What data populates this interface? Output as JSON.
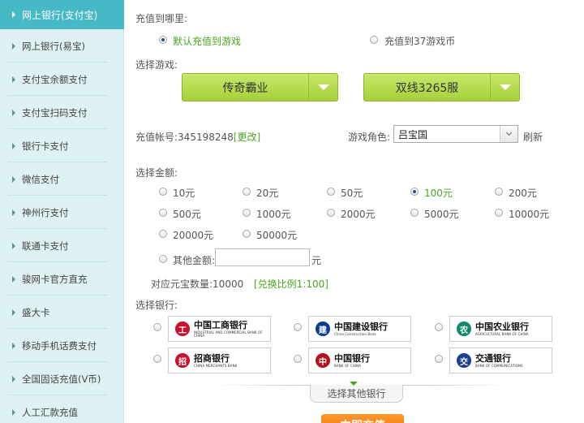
{
  "sidebar": {
    "items": [
      {
        "label": "网上银行(支付宝)",
        "active": true
      },
      {
        "label": "网上银行(易宝)"
      },
      {
        "label": "支付宝余额支付"
      },
      {
        "label": "支付宝扫码支付"
      },
      {
        "label": "银行卡支付"
      },
      {
        "label": "微信支付"
      },
      {
        "label": "神州行支付"
      },
      {
        "label": "联通卡支付"
      },
      {
        "label": "骏网卡官方直充"
      },
      {
        "label": "盛大卡"
      },
      {
        "label": "移动手机话费支付"
      },
      {
        "label": "全国固话充值(V币)"
      },
      {
        "label": "人工汇款充值"
      }
    ]
  },
  "recharge_target": {
    "label": "充值到哪里:",
    "options": [
      "默认充值到游戏",
      "充值到37游戏币"
    ],
    "selected": 0
  },
  "game_select": {
    "label": "选择游戏:",
    "game": "传奇霸业",
    "server": "双线3265服"
  },
  "account": {
    "label": "充值帐号:",
    "value": "345198248",
    "change_link": "[更改]",
    "role_label": "游戏角色:",
    "role_value": "吕宝国",
    "refresh": "刷新"
  },
  "amount": {
    "label": "选择金额:",
    "options": [
      "10元",
      "20元",
      "50元",
      "100元",
      "200元",
      "500元",
      "1000元",
      "2000元",
      "5000元",
      "10000元",
      "20000元",
      "50000元"
    ],
    "selected": 3,
    "other_label": "其他金额:",
    "other_value": "",
    "other_unit": "元",
    "yuanbao_label": "对应元宝数量:10000",
    "ratio_text": "[兑换比例1:100]"
  },
  "bank": {
    "label": "选择银行:",
    "banks": [
      {
        "cn": "中国工商银行",
        "en": "INDUSTRIAL AND COMMERCIAL BANK OF CHINA",
        "logo": "工",
        "color": "#c8102e"
      },
      {
        "cn": "中国建设银行",
        "en": "China Construction Bank",
        "logo": "建",
        "color": "#0a3d8f"
      },
      {
        "cn": "中国农业银行",
        "en": "AGRICULTURAL BANK OF CHINA",
        "logo": "农",
        "color": "#0f8a6b"
      },
      {
        "cn": "招商银行",
        "en": "CHINA MERCHANTS BANK",
        "logo": "招",
        "color": "#c8102e"
      },
      {
        "cn": "中国银行",
        "en": "BANK OF CHINA",
        "logo": "中",
        "color": "#b3131b"
      },
      {
        "cn": "交通银行",
        "en": "BANK OF COMMUNICATIONS",
        "logo": "交",
        "color": "#1c3f94"
      }
    ],
    "more": "选择其他银行"
  },
  "submit_label": "立即充值"
}
